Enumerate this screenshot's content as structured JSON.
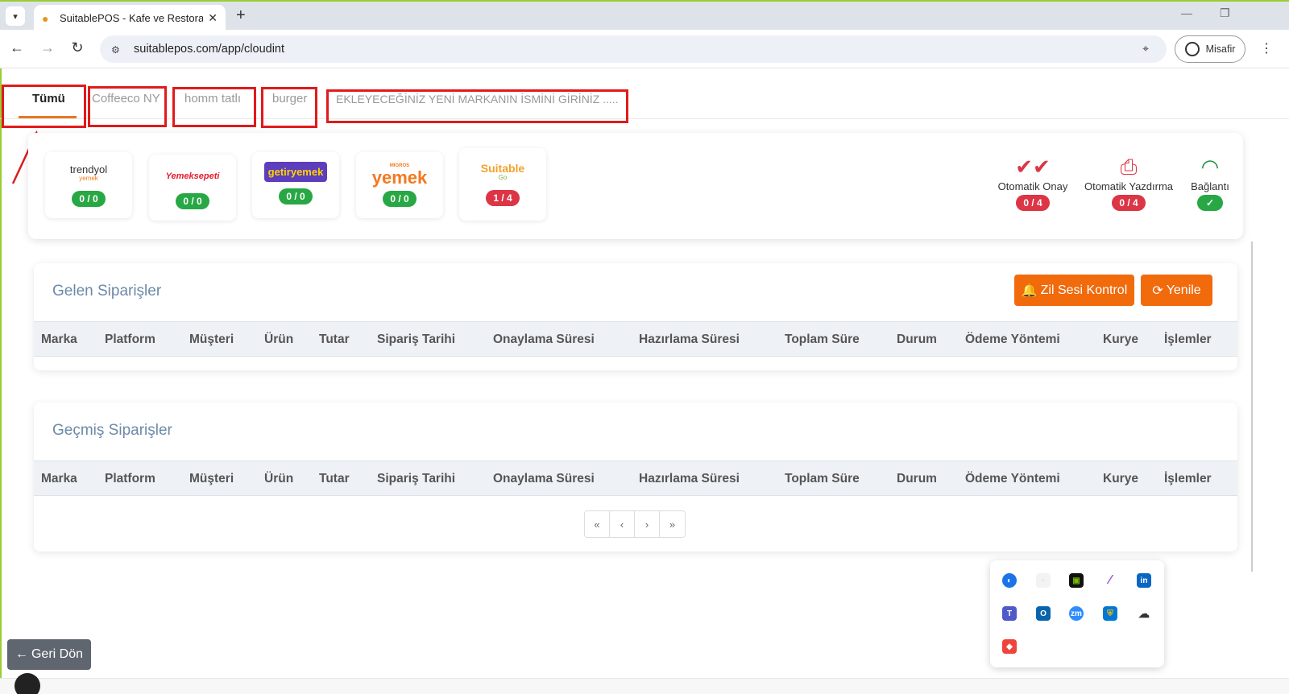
{
  "browser": {
    "tab_title": "SuitablePOS - Kafe ve Restoran",
    "url": "suitablepos.com/app/cloudint",
    "profile_label": "Misafir",
    "new_tab_symbol": "+",
    "close_symbol": "✕"
  },
  "brand_tabs": [
    "Tümü",
    "Coffeeco NY",
    "homm tatlı",
    "burger",
    "EKLEYECEĞİNİZ YENİ MARKANIN İSMİNİ GİRİNİZ ....."
  ],
  "platforms": [
    {
      "name": "trendyol",
      "sub": "yemek",
      "badge": "0 / 0",
      "badge_color": "#28a745"
    },
    {
      "name": "Yemeksepeti",
      "badge": "0 / 0",
      "badge_color": "#28a745"
    },
    {
      "name": "getiryemek",
      "badge": "0 / 0",
      "badge_color": "#28a745"
    },
    {
      "name": "yemek",
      "super": "MIGROS",
      "badge": "0 / 0",
      "badge_color": "#28a745"
    },
    {
      "name": "Suitable",
      "sub": "Go",
      "badge": "1 / 4",
      "badge_color": "#dc3545"
    }
  ],
  "status_items": [
    {
      "label": "Otomatik Onay",
      "badge": "0 / 4",
      "icon": "double-check-icon"
    },
    {
      "label": "Otomatik Yazdırma",
      "badge": "0 / 4",
      "icon": "printer-icon"
    },
    {
      "label": "Bağlantı",
      "badge": "✓",
      "icon": "wifi-icon"
    }
  ],
  "incoming": {
    "title": "Gelen Siparişler",
    "bell_button": "Zil Sesi Kontrol",
    "refresh_button": "Yenile"
  },
  "past": {
    "title": "Geçmiş Siparişler"
  },
  "columns": [
    "Marka",
    "Platform",
    "Müşteri",
    "Ürün",
    "Tutar",
    "Sipariş Tarihi",
    "Onaylama Süresi",
    "Hazırlama Süresi",
    "Toplam Süre",
    "Durum",
    "Ödeme Yöntemi",
    "Kurye",
    "İşlemler"
  ],
  "pagination": [
    "«",
    "‹",
    "›",
    "»"
  ],
  "back_button": "Geri Dön",
  "tray_icons": [
    "app-icon",
    "blank-icon",
    "nvidia-icon",
    "pen-icon",
    "linkedin-icon",
    "teams-icon",
    "outlook-icon",
    "zoom-icon",
    "defender-icon",
    "onedrive-icon",
    "anydesk-icon"
  ],
  "colors": {
    "accent": "#f16a0c",
    "active_tab_underline": "#e87722",
    "annotation_red": "#e01b1b",
    "ok_green": "#28a745",
    "alert_red": "#dc3545"
  }
}
